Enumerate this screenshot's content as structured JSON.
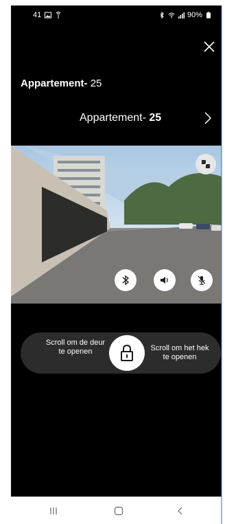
{
  "status_bar": {
    "time": "41",
    "battery": "90%"
  },
  "header": {
    "title_bold": "Appartement-",
    "title_num": "25"
  },
  "door": {
    "name": "Appartement-",
    "num": "25"
  },
  "slider": {
    "left_label": "Scroll om de deur te openen",
    "right_label": "Scroll om het hek te openen"
  },
  "icons": {
    "close": "close-icon",
    "chevron": "chevron-right-icon",
    "expand": "expand-icon",
    "bluetooth": "bluetooth-icon",
    "volume": "volume-icon",
    "mic": "mic-off-icon",
    "lock": "lock-icon"
  },
  "colors": {
    "background": "#000000",
    "slider_bg": "#2c2c2c",
    "accent": "#ffffff"
  }
}
